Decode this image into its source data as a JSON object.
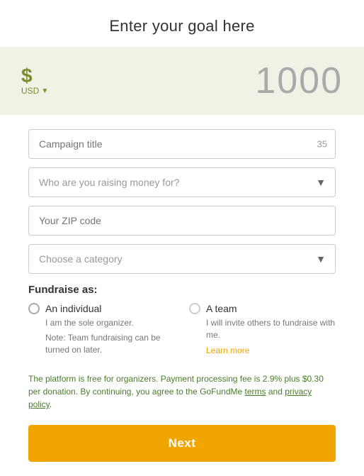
{
  "header": {
    "title": "Enter your goal here"
  },
  "goal": {
    "currency_symbol": "$",
    "currency_code": "USD",
    "amount": "1000"
  },
  "form": {
    "campaign_title_placeholder": "Campaign title",
    "campaign_title_char_count": "35",
    "raising_for_placeholder": "Who are you raising money for?",
    "zip_code_placeholder": "Your ZIP code",
    "choose_category_placeholder": "Choose a category"
  },
  "fundraise": {
    "label": "Fundraise as:",
    "individual_option": "An individual",
    "individual_desc": "I am the sole organizer.",
    "individual_note": "Note: Team fundraising can be turned on later.",
    "team_option": "A team",
    "team_desc": "I will invite others to fundraise with me.",
    "learn_more_text": "Learn more"
  },
  "legal": {
    "text_start": "The platform is free for organizers. Payment processing fee is 2.9% plus $0.30 per donation. By continuing, you agree to the GoFundMe ",
    "terms_link": "terms",
    "text_middle": " and ",
    "privacy_link": "privacy policy",
    "text_end": "."
  },
  "next_button": {
    "label": "Next"
  }
}
